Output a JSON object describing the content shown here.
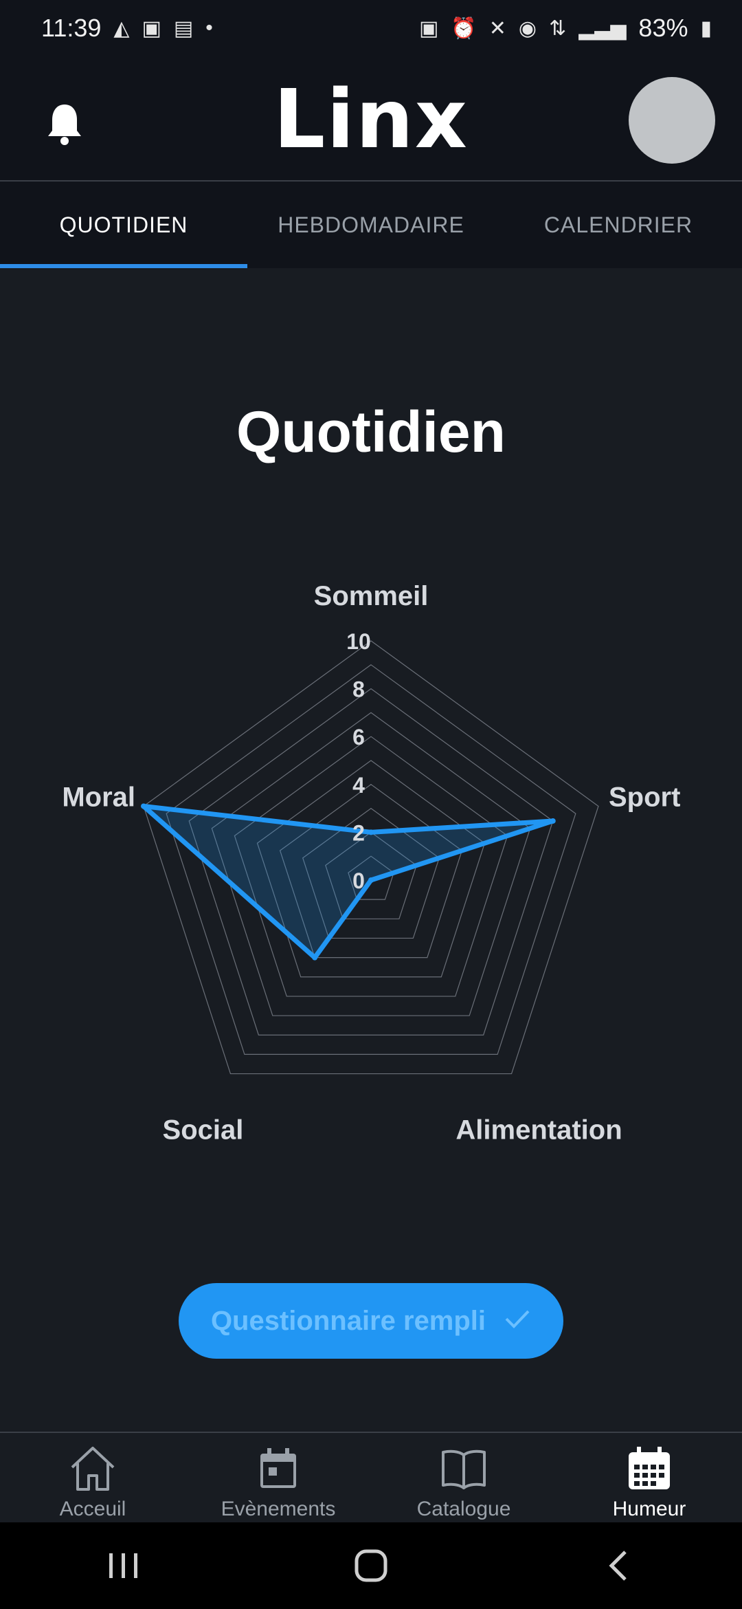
{
  "status_bar": {
    "time": "11:39",
    "battery": "83%"
  },
  "header": {
    "app_name": "Linx"
  },
  "tabs": [
    {
      "label": "QUOTIDIEN"
    },
    {
      "label": "HEBDOMADAIRE"
    },
    {
      "label": "CALENDRIER"
    }
  ],
  "page": {
    "title": "Quotidien"
  },
  "chart_data": {
    "type": "radar",
    "axes": [
      "Sommeil",
      "Sport",
      "Alimentation",
      "Social",
      "Moral"
    ],
    "values": [
      2,
      8,
      0,
      4,
      10
    ],
    "rmax": 10,
    "tick_labels": [
      "0",
      "2",
      "4",
      "6",
      "8",
      "10"
    ],
    "series_color": "#2196f3"
  },
  "cta": {
    "label": "Questionnaire rempli",
    "icon": "check-icon"
  },
  "bottom_nav": [
    {
      "label": "Acceuil",
      "icon": "home-icon"
    },
    {
      "label": "Evènements",
      "icon": "calendar-icon"
    },
    {
      "label": "Catalogue",
      "icon": "book-icon"
    },
    {
      "label": "Humeur",
      "icon": "calendar-grid-icon"
    }
  ],
  "colors": {
    "accent": "#2196f3",
    "background": "#181c22",
    "header": "#10131a"
  }
}
